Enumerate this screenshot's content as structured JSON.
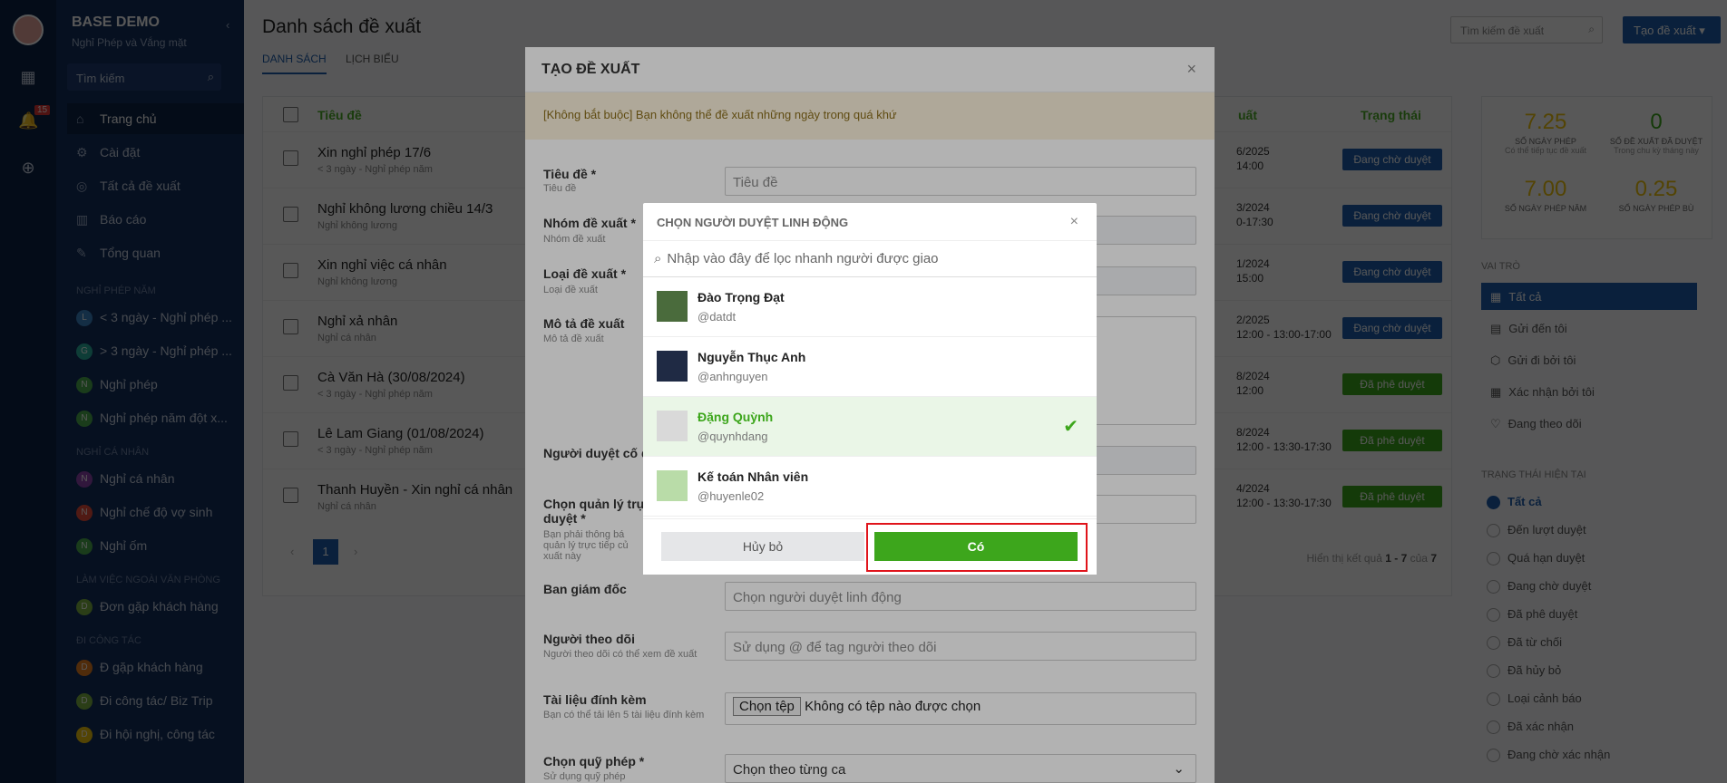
{
  "app": {
    "title": "BASE DEMO",
    "subtitle": "Nghỉ Phép và Vắng mặt",
    "notification_count": "15"
  },
  "sidebar": {
    "search_placeholder": "Tìm kiếm",
    "items": [
      {
        "label": "Trang chủ",
        "icon": "home-icon"
      },
      {
        "label": "Cài đặt",
        "icon": "gear-icon"
      },
      {
        "label": "Tất cả đề xuất",
        "icon": "target-icon"
      },
      {
        "label": "Báo cáo",
        "icon": "chart-icon"
      },
      {
        "label": "Tổng quan",
        "icon": "edit-icon"
      }
    ],
    "sections": [
      {
        "title": "NGHỈ PHÉP NĂM",
        "items": [
          {
            "letter": "L",
            "color": "#3a86c8",
            "label": "< 3 ngày - Nghỉ phép ..."
          },
          {
            "letter": "G",
            "color": "#2bb0a0",
            "label": "> 3 ngày - Nghỉ phép ..."
          },
          {
            "letter": "N",
            "color": "#4caf50",
            "label": "Nghỉ phép"
          },
          {
            "letter": "N",
            "color": "#4caf50",
            "label": "Nghỉ phép năm đột x..."
          }
        ]
      },
      {
        "title": "NGHỈ CÁ NHÂN",
        "items": [
          {
            "letter": "N",
            "color": "#8e44ad",
            "label": "Nghỉ cá nhân"
          },
          {
            "letter": "N",
            "color": "#e74c3c",
            "label": "Nghỉ chế độ vợ sinh"
          },
          {
            "letter": "N",
            "color": "#4caf50",
            "label": "Nghỉ ốm"
          }
        ]
      },
      {
        "title": "LÀM VIỆC NGOÀI VĂN PHÒNG",
        "items": [
          {
            "letter": "D",
            "color": "#7cb342",
            "label": "Đơn gặp khách hàng"
          }
        ]
      },
      {
        "title": "ĐI CÔNG TÁC",
        "items": [
          {
            "letter": "D",
            "color": "#e67e22",
            "label": "Đ gặp khách hàng"
          },
          {
            "letter": "D",
            "color": "#7cb342",
            "label": "Đi công tác/ Biz Trip"
          },
          {
            "letter": "D",
            "color": "#f1c40f",
            "label": "Đi hội nghị, công tác"
          }
        ]
      }
    ]
  },
  "main": {
    "title": "Danh sách đề xuất",
    "tabs": [
      "DANH SÁCH",
      "LỊCH BIỂU"
    ],
    "search_placeholder": "Tìm kiếm đề xuất",
    "create_button": "Tạo đề xuất",
    "col_title": "Tiêu đề",
    "col_date": "uất",
    "col_status": "Trạng thái",
    "rows": [
      {
        "title": "Xin nghỉ phép 17/6",
        "sub": "< 3 ngày - Nghỉ phép năm",
        "d1": "6/2025",
        "d2": "14:00",
        "status": "Đang chờ duyệt",
        "color": "#1e5fae"
      },
      {
        "title": "Nghỉ không lương chiều 14/3",
        "sub": "Nghỉ không lương",
        "d1": "3/2024",
        "d2": "0-17:30",
        "status": "Đang chờ duyệt",
        "color": "#1e5fae"
      },
      {
        "title": "Xin nghỉ việc cá nhân",
        "sub": "Nghỉ không lương",
        "d1": "1/2024",
        "d2": "15:00",
        "status": "Đang chờ duyệt",
        "color": "#1e5fae"
      },
      {
        "title": "Nghỉ xả nhân",
        "sub": "Nghỉ cá nhân",
        "d1": "2/2025",
        "d2": "12:00 - 13:00-17:00",
        "status": "Đang chờ duyệt",
        "color": "#1e5fae"
      },
      {
        "title": "Cà Văn Hà (30/08/2024)",
        "sub": "< 3 ngày - Nghỉ phép năm",
        "d1": "8/2024",
        "d2": "12:00",
        "status": "Đã phê duyệt",
        "color": "#3da61c"
      },
      {
        "title": "Lê Lam Giang (01/08/2024)",
        "sub": "< 3 ngày - Nghỉ phép năm",
        "d1": "8/2024",
        "d2": "12:00 - 13:30-17:30",
        "status": "Đã phê duyệt",
        "color": "#3da61c"
      },
      {
        "title": "Thanh Huyền - Xin nghỉ cá nhân",
        "sub": "Nghỉ cá nhân",
        "d1": "4/2024",
        "d2": "12:00 - 13:30-17:30",
        "status": "Đã phê duyệt",
        "color": "#3da61c"
      }
    ],
    "page": "1",
    "results_prefix": "Hiển thị kết quả",
    "results_range": "1 - 7",
    "results_of": "của",
    "results_total": "7"
  },
  "stats": [
    {
      "value": "7.25",
      "label": "SỐ NGÀY PHÉP",
      "sub": "Có thể tiếp tục đề xuất",
      "color": "#f1c40f"
    },
    {
      "value": "0",
      "label": "SỐ ĐỀ XUẤT ĐÃ DUYỆT",
      "sub": "Trong chu kỳ tháng này",
      "color": "#3da61c"
    },
    {
      "value": "7.00",
      "label": "SỐ NGÀY PHÉP NĂM",
      "sub": "",
      "color": "#f1c40f"
    },
    {
      "value": "0.25",
      "label": "SỐ NGÀY PHÉP BÙ",
      "sub": "",
      "color": "#f1c40f"
    }
  ],
  "roles": {
    "title": "VAI TRÒ",
    "items": [
      "Tất cả",
      "Gửi đến tôi",
      "Gửi đi bởi tôi",
      "Xác nhận bởi tôi",
      "Đang theo dõi"
    ]
  },
  "current_status": {
    "title": "TRẠNG THÁI HIỆN TẠI",
    "items": [
      "Tất cả",
      "Đến lượt duyệt",
      "Quá hạn duyệt",
      "Đang chờ duyệt",
      "Đã phê duyệt",
      "Đã từ chối",
      "Đã hủy bỏ",
      "Loại cảnh báo",
      "Đã xác nhận",
      "Đang chờ xác nhận"
    ]
  },
  "modal": {
    "title": "TẠO ĐỀ XUẤT",
    "notice": "[Không bắt buộc] Bạn không thể đề xuất những ngày trong quá khứ",
    "fields": {
      "title_label": "Tiêu đề *",
      "title_desc": "Tiêu đề",
      "title_placeholder": "Tiêu đề",
      "group_label": "Nhóm đề xuất *",
      "group_desc": "Nhóm đề xuất",
      "type_label": "Loại đề xuất *",
      "type_desc": "Loại đề xuất",
      "desc_label": "Mô tả đề xuất",
      "desc_desc": "Mô tả đề xuất",
      "fixed_label": "Người duyệt cố đị",
      "manager_label": "Chọn quản lý trực",
      "manager_label2": "duyệt *",
      "manager_desc": "Bạn phải thông bá quản lý trực tiếp củ xuất này",
      "director_label": "Ban giám đốc",
      "director_placeholder": "Chọn người duyệt linh động",
      "follower_label": "Người theo dõi",
      "follower_desc": "Người theo dõi có thể xem đề xuất",
      "follower_placeholder": "Sử dụng @ để tag người theo dõi",
      "attach_label": "Tài liệu đính kèm",
      "attach_desc": "Bạn có thể tải lên 5 tài liệu đính kèm",
      "file_button": "Chọn tệp",
      "file_none": "Không có tệp nào được chọn",
      "fund_label": "Chọn quỹ phép *",
      "fund_desc": "Sử dụng quỹ phép",
      "fund_value": "Chọn theo từng ca"
    }
  },
  "dialog": {
    "title": "CHỌN NGƯỜI DUYỆT LINH ĐỘNG",
    "search_placeholder": "Nhập vào đây để lọc nhanh người được giao",
    "people": [
      {
        "name": "Đào Trọng Đạt",
        "user": "@datdt",
        "selected": false
      },
      {
        "name": "Nguyễn Thục Anh",
        "user": "@anhnguyen",
        "selected": false
      },
      {
        "name": "Đặng Quỳnh",
        "user": "@quynhdang",
        "selected": true
      },
      {
        "name": "Kế toán Nhân viên",
        "user": "@huyenle02",
        "selected": false
      }
    ],
    "cancel": "Hủy bỏ",
    "confirm": "Có"
  }
}
